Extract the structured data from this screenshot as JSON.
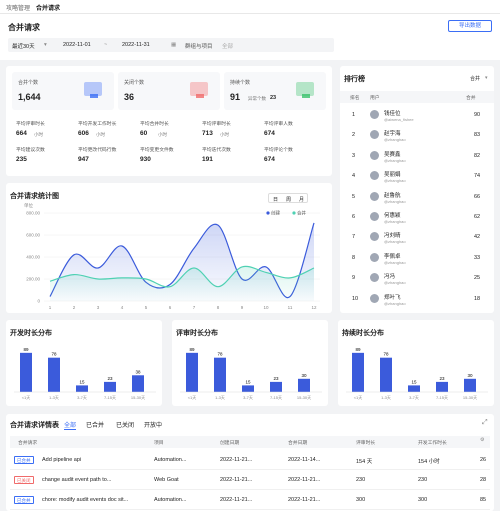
{
  "topbar": {
    "nav1": "攻略管理",
    "nav2": "合并请求"
  },
  "header": {
    "title": "合并请求",
    "export_label": "导出数据"
  },
  "filters": {
    "range_select": "最近30天",
    "date_from": "2022-11-01",
    "date_sep": "~",
    "date_to": "2022-11-31",
    "project_label": "群组与项目",
    "project_value": "全部"
  },
  "stats": [
    {
      "label": "合并个数",
      "value": "1,644",
      "color": "#3b6ef5"
    },
    {
      "label": "关闭个数",
      "value": "36",
      "color": "#f06a6a"
    },
    {
      "label": "持续个数",
      "value": "91",
      "suffix_label": "异常个数",
      "suffix_value": "23",
      "color": "#39c26b"
    }
  ],
  "metrics": [
    {
      "label": "平均评审时长",
      "value": "664",
      "unit": "小时"
    },
    {
      "label": "平均开发工作时长",
      "value": "606",
      "unit": "小时"
    },
    {
      "label": "平均合并时长",
      "value": "60",
      "unit": "小时"
    },
    {
      "label": "平均评审时长",
      "value": "713",
      "unit": "小时"
    },
    {
      "label": "平均评审人数",
      "value": "674",
      "unit": ""
    },
    {
      "label": "平均建议次数",
      "value": "235",
      "unit": ""
    },
    {
      "label": "平均更改代码行数",
      "value": "947",
      "unit": ""
    },
    {
      "label": "平均变更文件数",
      "value": "930",
      "unit": ""
    },
    {
      "label": "平均迭代次数",
      "value": "191",
      "unit": ""
    },
    {
      "label": "平均评论个数",
      "value": "674",
      "unit": ""
    }
  ],
  "trend": {
    "title": "合并请求统计图",
    "toggles": [
      "日",
      "周",
      "月"
    ],
    "legend": [
      "创建",
      "合并"
    ],
    "ylabel": "单位",
    "chart_data": {
      "type": "line",
      "x": [
        "1",
        "2",
        "3",
        "4",
        "5",
        "6",
        "7",
        "8",
        "9",
        "10",
        "11",
        "12"
      ],
      "ylim": [
        0,
        800
      ],
      "yticks": [
        "800.00",
        "600.00",
        "400.00",
        "200.00",
        "0"
      ],
      "series": [
        {
          "name": "创建",
          "color": "#3b5bdb",
          "values": [
            40,
            420,
            300,
            500,
            170,
            150,
            480,
            690,
            200,
            310,
            40,
            710
          ]
        },
        {
          "name": "合并",
          "color": "#4fd1b3",
          "values": [
            180,
            240,
            200,
            210,
            200,
            130,
            300,
            130,
            310,
            260,
            210,
            300
          ]
        }
      ]
    }
  },
  "ranking": {
    "title": "排行榜",
    "filter": "合并",
    "col_rank": "排名",
    "col_user": "用户",
    "col_count": "合并",
    "rows": [
      {
        "rank": "1",
        "name": "钱佳位",
        "handle": "@aiwena_fishee",
        "count": "90"
      },
      {
        "rank": "2",
        "name": "赵宇海",
        "handle": "@zhanghao",
        "count": "83"
      },
      {
        "rank": "3",
        "name": "吴赛鑫",
        "handle": "@zhanghao",
        "count": "82"
      },
      {
        "rank": "4",
        "name": "吴丽娟",
        "handle": "@zhanghao",
        "count": "74"
      },
      {
        "rank": "5",
        "name": "赵鲁航",
        "handle": "@zhanghao",
        "count": "66"
      },
      {
        "rank": "6",
        "name": "何惠颖",
        "handle": "@zhanghao",
        "count": "62"
      },
      {
        "rank": "7",
        "name": "冯刘晴",
        "handle": "@zhanghao",
        "count": "42"
      },
      {
        "rank": "8",
        "name": "李佩卓",
        "handle": "@zhanghao",
        "count": "33"
      },
      {
        "rank": "9",
        "name": "冯冯",
        "handle": "@zhanghao",
        "count": "25"
      },
      {
        "rank": "10",
        "name": "郑叶飞",
        "handle": "@zhanghao",
        "count": "18"
      }
    ]
  },
  "distributions": [
    {
      "title": "开发时长分布",
      "chart_data": {
        "type": "bar",
        "categories": [
          "<1天",
          "1-3天",
          "3-7天",
          "7-15天",
          "15-30天"
        ],
        "values": [
          89,
          78,
          15,
          23,
          38
        ]
      }
    },
    {
      "title": "评审时长分布",
      "chart_data": {
        "type": "bar",
        "categories": [
          "<1天",
          "1-3天",
          "3-7天",
          "7-15天",
          "15-30天"
        ],
        "values": [
          89,
          78,
          15,
          23,
          30
        ]
      }
    },
    {
      "title": "持续时长分布",
      "chart_data": {
        "type": "bar",
        "categories": [
          "<1天",
          "1-3天",
          "3-7天",
          "7-15天",
          "15-30天"
        ],
        "values": [
          89,
          78,
          15,
          23,
          30
        ]
      }
    }
  ],
  "table": {
    "title": "合并请求详情表",
    "tabs": [
      "全部",
      "已合并",
      "已关闭",
      "开放中"
    ],
    "headers": [
      "合并请求",
      "项目",
      "创建日期",
      "合并日期",
      "评审时长",
      "开发工作时长",
      ""
    ],
    "rows": [
      {
        "tag": "已合并",
        "tag_color": "#3b6ef5",
        "title": "Add pipeline api",
        "project": "Automation...",
        "created": "2022-11-21...",
        "merged": "2022-11-14...",
        "review": "154 天",
        "dev": "154 小时",
        "n": "26"
      },
      {
        "tag": "已关闭",
        "tag_color": "#f06a6a",
        "title": "change audit event path to...",
        "project": "Web Goat",
        "created": "2022-11-21...",
        "merged": "2022-11-21...",
        "review": "230",
        "dev": "230",
        "n": "28"
      },
      {
        "tag": "已合并",
        "tag_color": "#3b6ef5",
        "title": "chore: modify audit events doc sit...",
        "project": "Automation...",
        "created": "2022-11-21...",
        "merged": "2022-11-21...",
        "review": "300",
        "dev": "300",
        "n": "85"
      }
    ]
  }
}
